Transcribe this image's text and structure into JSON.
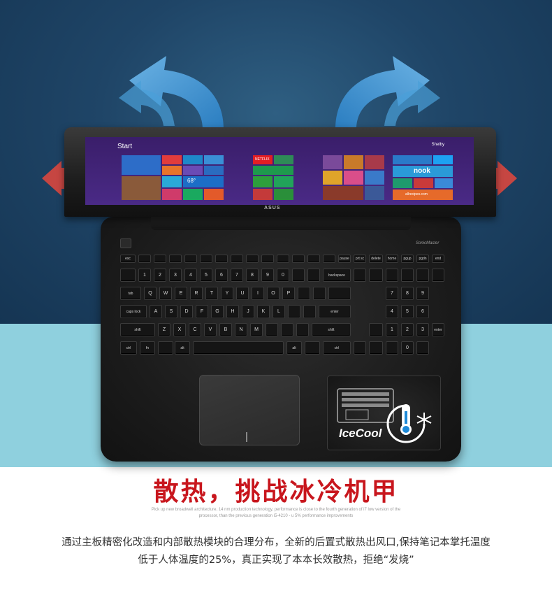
{
  "screen": {
    "start_label": "Start",
    "user_label": "Shelby",
    "weather_temp": "68°",
    "app_labels": {
      "netflix": "NETFLIX",
      "nook": "nook",
      "allrecipes": "allrecipes.com"
    }
  },
  "laptop": {
    "brand": "ASUS",
    "audio_brand": "SonicMaster",
    "keys": {
      "esc": "esc",
      "home": "home",
      "pgup": "pgup",
      "pgdn": "pgdn",
      "end": "end",
      "backspace": "backspace",
      "tab": "tab",
      "caps": "caps lock",
      "enter": "enter",
      "shift": "shift",
      "ctrl": "ctrl",
      "fn": "fn",
      "alt": "alt",
      "pause": "pause",
      "prtsc": "prt sc",
      "delete": "delete",
      "q": "Q",
      "w": "W",
      "e": "E",
      "r": "R",
      "t": "T",
      "y": "Y",
      "u": "U",
      "i": "I",
      "o": "O",
      "p": "P",
      "a": "A",
      "s": "S",
      "d": "D",
      "f": "F",
      "g": "G",
      "h": "H",
      "j": "J",
      "k": "K",
      "l": "L",
      "z": "Z",
      "x": "X",
      "c": "C",
      "v": "V",
      "b": "B",
      "n": "N",
      "m": "M",
      "n1": "1",
      "n2": "2",
      "n3": "3",
      "n4": "4",
      "n5": "5",
      "n6": "6",
      "n7": "7",
      "n8": "8",
      "n9": "9",
      "n0": "0",
      "np7": "7",
      "np8": "8",
      "np9": "9",
      "np4": "4",
      "np5": "5",
      "np6": "6",
      "np1": "1",
      "np2": "2",
      "np3": "3",
      "np0": "0"
    }
  },
  "badge": {
    "label": "IceCool"
  },
  "headline": "散热，挑战冰冷机甲",
  "subtitle_en": [
    "Pick up new broadwell architecture, 14 nm production technology, performance is close to the fourth generation of i7 low version of the",
    "processor, than the previous generation i5-4210 - u 5% performance improvements"
  ],
  "description": [
    "通过主板精密化改造和内部散热模块的合理分布，全新的后置式散热出风口,保持笔记本掌托温度",
    "低于人体温度的25%，真正实现了本本长效散热，拒绝“发烧”"
  ],
  "colors": {
    "headline": "#c8161d",
    "arrow_blue": "#4a9fd8",
    "arrow_red": "#d9473f",
    "band_cyan": "#8fd0de"
  }
}
